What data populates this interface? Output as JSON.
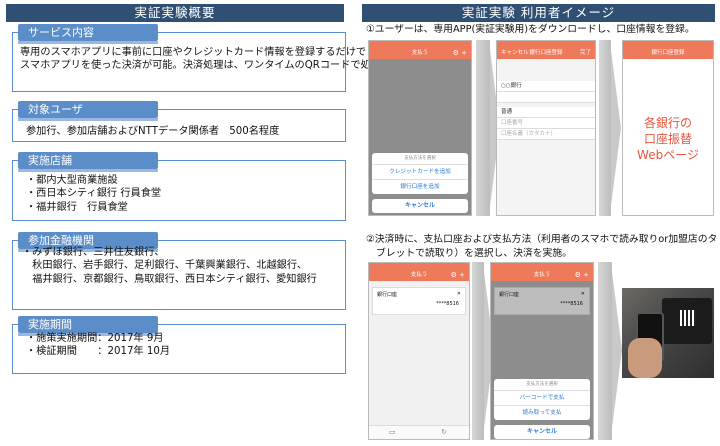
{
  "left_title": "実証実験概要",
  "right_title": "実証実験 利用者イメージ",
  "sections": {
    "service": {
      "title": "サービス内容",
      "lines": [
        "専用のスマホアプリに事前に口座やクレジットカード情報を登録するだけで",
        "スマホアプリを使った決済が可能。決済処理は、ワンタイムのQRコードで処理。"
      ]
    },
    "users": {
      "title": "対象ユーザ",
      "lines": [
        "参加行、参加店舗およびNTTデータ関係者　500名程度"
      ]
    },
    "stores": {
      "title": "実施店舗",
      "lines": [
        "・都内大型商業施設",
        "・西日本シティ銀行 行員食堂",
        "・福井銀行　行員食堂"
      ]
    },
    "banks": {
      "title": "参加金融機関",
      "lines": [
        "・みずほ銀行、三井住友銀行、",
        "　秋田銀行、岩手銀行、足利銀行、千葉興業銀行、北越銀行、",
        "　福井銀行、京都銀行、鳥取銀行、西日本シティ銀行、愛知銀行"
      ]
    },
    "period": {
      "title": "実施期間",
      "lines": [
        "・施策実施期間：2017年 9月",
        "・検証期間　　：2017年 10月"
      ]
    }
  },
  "steps": {
    "step1": "①ユーザーは、専用APP(実証実験用)をダウンロードし、口座情報を登録。",
    "step2_l1": "②決済時に、支払口座および支払方法（利用者のスマホで読み取りor加盟店のタ",
    "step2_l2": "ブレットで読取り）を選択し、決済を実施。"
  },
  "phone1": {
    "title": "支払う",
    "sheet_head": "支払方法を選択",
    "item1": "クレジットカードを追加",
    "item2": "銀行口座を追加",
    "cancel": "キャンセル"
  },
  "phone2": {
    "cancel_link": "キャンセル",
    "title": "銀行口座登録",
    "done": "完了",
    "fields": [
      "○○銀行",
      "",
      "普通",
      "口座番号",
      "口座名義（カタカナ）"
    ]
  },
  "phone3": {
    "title": "銀行口座登録",
    "web_text": [
      "各銀行の",
      "口座振替",
      "Webページ"
    ]
  },
  "phone4": {
    "title": "支払う",
    "card_label": "銀行口座",
    "card_number": "****8516"
  },
  "phone5": {
    "title": "支払う",
    "card_label": "銀行口座",
    "card_number": "****8516",
    "sheet_head": "支払方法を選択",
    "item1": "バーコードで支払",
    "item2": "読み取って支払",
    "cancel": "キャンセル"
  },
  "colors": {
    "banner": "#2f4f73",
    "section_title": "#5b8dc9",
    "app_accent": "#ef7a5b",
    "web_text": "#e8553c",
    "link": "#2a7bd6"
  }
}
